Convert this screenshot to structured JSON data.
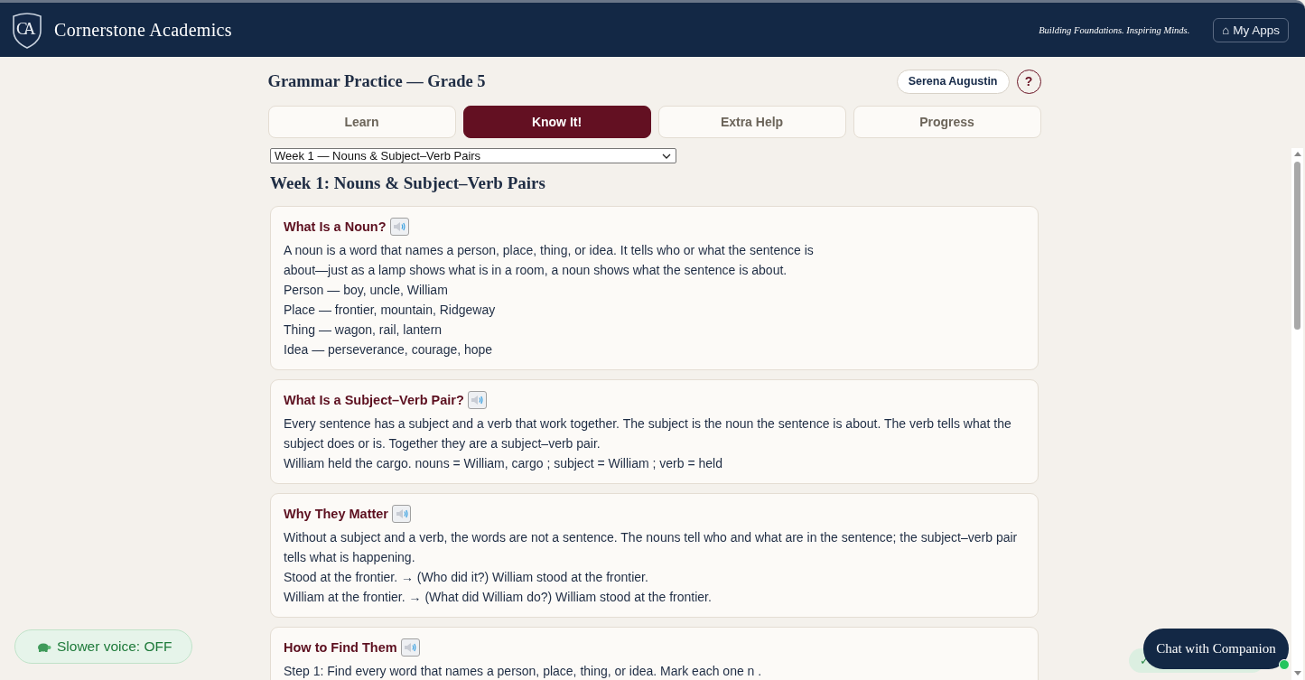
{
  "header": {
    "logo_text": "CA",
    "brand": "Cornerstone Academics",
    "tagline": "Building Foundations. Inspiring Minds.",
    "apps_button": "⌂ My Apps"
  },
  "page": {
    "title": "Grammar Practice — Grade 5",
    "user": "Serena Augustin",
    "help": "?"
  },
  "tabs": [
    {
      "label": "Learn",
      "selected": false
    },
    {
      "label": "Know It!",
      "selected": true
    },
    {
      "label": "Extra Help",
      "selected": false
    },
    {
      "label": "Progress",
      "selected": false
    }
  ],
  "week_select": {
    "value": "Week 1 — Nouns & Subject–Verb Pairs"
  },
  "section_title": "Week 1: Nouns & Subject–Verb Pairs",
  "cards": [
    {
      "title": "What Is a Noun?",
      "lines": [
        "A noun is a word that names a person, place, thing, or idea. It tells who or what the sentence is",
        "about—just as a lamp shows what is in a room, a noun shows what the sentence is about.",
        "Person — boy, uncle, William",
        "Place — frontier, mountain, Ridgeway",
        "Thing — wagon, rail, lantern",
        "Idea — perseverance, courage, hope"
      ]
    },
    {
      "title": "What Is a Subject–Verb Pair?",
      "lines": [
        "Every sentence has a subject and a verb that work together. The subject is the noun the sentence is about. The verb tells what the subject does or is. Together they are a subject–verb pair.",
        "William held the cargo. nouns = William, cargo ; subject = William ; verb = held"
      ]
    },
    {
      "title": "Why They Matter",
      "lines": [
        "Without a subject and a verb, the words are not a sentence. The nouns tell who and what are in the sentence; the subject–verb pair tells what is happening.",
        "Stood at the frontier. → (Who did it?) William stood at the frontier.",
        "William at the frontier. → (What did William do?) William stood at the frontier."
      ]
    },
    {
      "title": "How to Find Them",
      "lines": [
        "Step 1: Find every word that names a person, place, thing, or idea. Mark each one n ."
      ]
    }
  ],
  "voice_toggle": {
    "label": "Slower voice: OFF",
    "on": false
  },
  "status_pill": {
    "text": "✓"
  },
  "chat_button": {
    "label": "Chat with Companion",
    "online": true
  }
}
